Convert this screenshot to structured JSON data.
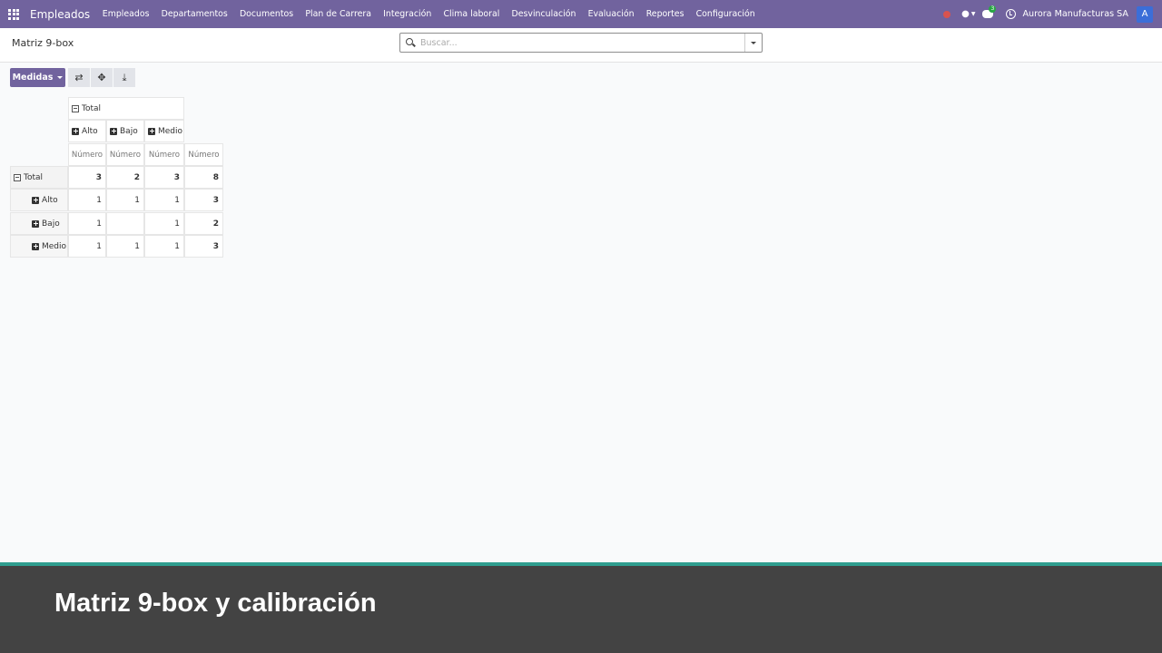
{
  "navbar": {
    "brand": "Empleados",
    "menu": [
      "Empleados",
      "Departamentos",
      "Documentos",
      "Plan de Carrera",
      "Integración",
      "Clima laboral",
      "Desvinculación",
      "Evaluación",
      "Reportes",
      "Configuración"
    ],
    "chat_count": "3",
    "company": "Aurora Manufacturas SA",
    "avatar_letter": "A",
    "icons": [
      "apps-grid-icon",
      "recording-dot-icon",
      "drop-icon",
      "chat-icon",
      "clock-icon"
    ]
  },
  "control_panel": {
    "title": "Matriz 9-box",
    "search_placeholder": "Buscar..."
  },
  "toolbar": {
    "measures_label": "Medidas",
    "icons": [
      "flip-axis-icon",
      "expand-all-icon",
      "download-icon"
    ]
  },
  "pivot": {
    "col_total": "Total",
    "col_groups": [
      "Alto",
      "Bajo",
      "Medio"
    ],
    "measure": "Número",
    "row_total": "Total",
    "total_values": [
      "3",
      "2",
      "3",
      "8"
    ],
    "rows": [
      {
        "label": "Alto",
        "values": [
          "1",
          "1",
          "1",
          "3"
        ]
      },
      {
        "label": "Bajo",
        "values": [
          "1",
          "",
          "1",
          "2"
        ]
      },
      {
        "label": "Medio",
        "values": [
          "1",
          "1",
          "1",
          "3"
        ]
      }
    ]
  },
  "banner": {
    "title": "Matriz 9-box y calibración"
  }
}
